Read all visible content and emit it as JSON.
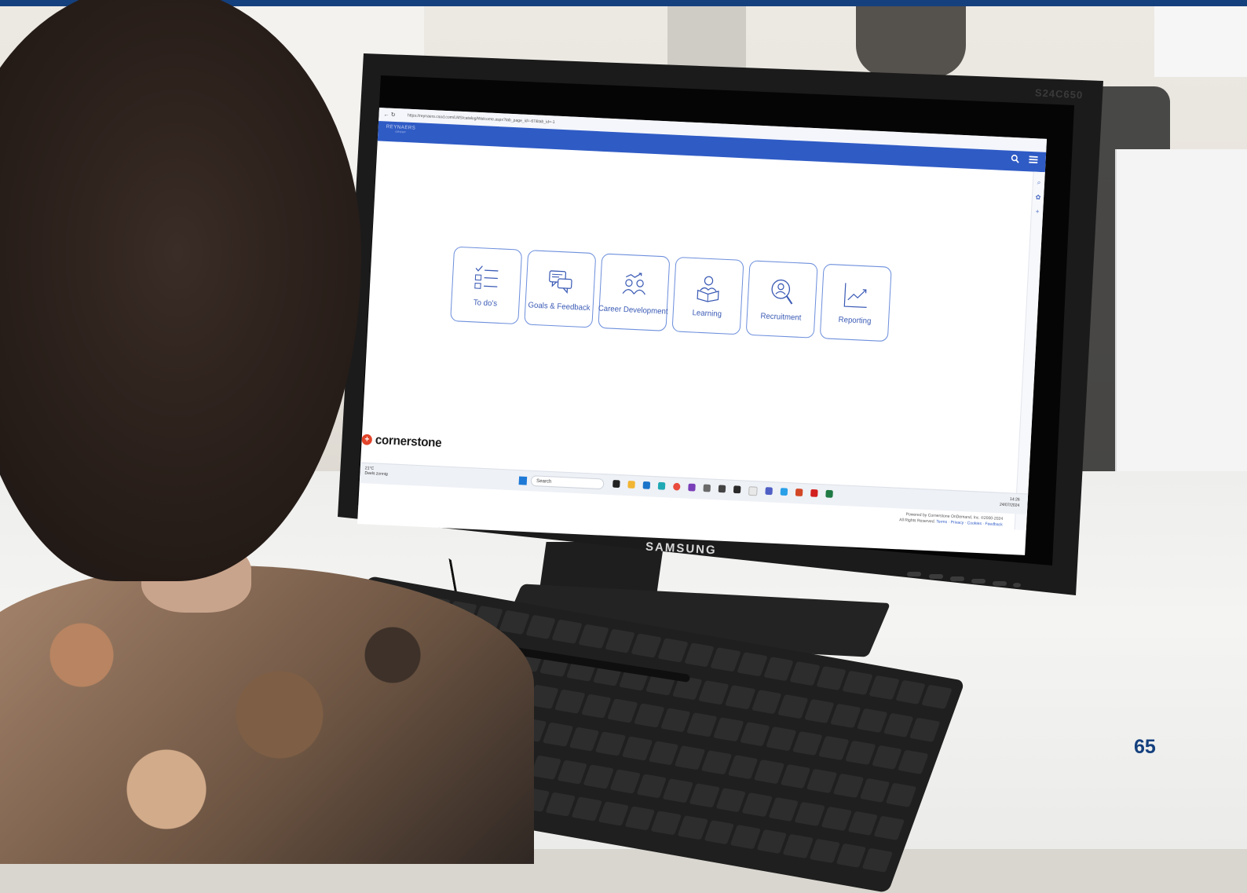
{
  "page_number": "65",
  "monitor": {
    "brand": "SAMSUNG",
    "model": "S24C650"
  },
  "browser": {
    "url": "https://reynaers.csod.com/LMS/catalog/Welcome.aspx?tab_page_id=-67&tab_id=-1"
  },
  "app": {
    "logo_top": "REYNAERS",
    "logo_bottom": "GROUP",
    "tiles": [
      {
        "label": "To do's",
        "icon": "checklist-icon"
      },
      {
        "label": "Goals & Feedback",
        "icon": "chat-bubbles-icon"
      },
      {
        "label": "Career Development",
        "icon": "people-growth-icon"
      },
      {
        "label": "Learning",
        "icon": "reader-book-icon"
      },
      {
        "label": "Recruitment",
        "icon": "magnify-person-icon"
      },
      {
        "label": "Reporting",
        "icon": "trend-chart-icon"
      }
    ],
    "brand": "cornerstone",
    "footer_line1": "Powered by Cornerstone OnDemand, Inc. ©2000-2024",
    "footer_line2": "All Rights Reserved.",
    "footer_links": "Terms · Privacy · Cookies · Feedback"
  },
  "taskbar": {
    "weather_temp": "21°C",
    "weather_desc": "Deels zonnig",
    "search_placeholder": "Search",
    "time": "14:26",
    "date": "24/07/2024"
  },
  "colors": {
    "header_blue": "#2f5bc5",
    "tile_border": "#6d8fdc",
    "cornerstone_red": "#e2452b",
    "page_blue": "#14407e"
  }
}
